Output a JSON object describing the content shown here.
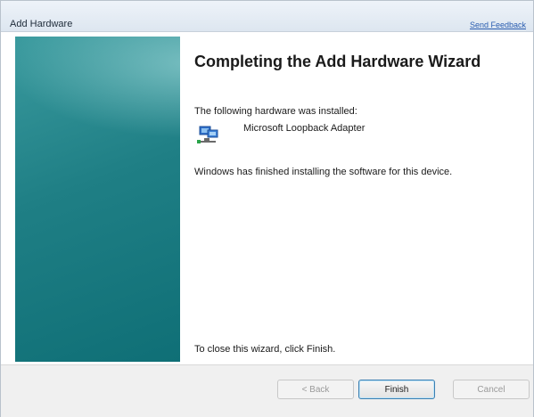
{
  "window": {
    "title": "Add Hardware",
    "send_feedback": "Send Feedback"
  },
  "content": {
    "heading": "Completing the Add Hardware Wizard",
    "intro": "The following hardware was installed:",
    "device_name": "Microsoft Loopback Adapter",
    "device_icon": "network-adapter-icon",
    "finished_msg": "Windows has finished installing the software for this device.",
    "close_msg": "To close this wizard, click Finish."
  },
  "buttons": {
    "back": "< Back",
    "finish": "Finish",
    "cancel": "Cancel"
  }
}
